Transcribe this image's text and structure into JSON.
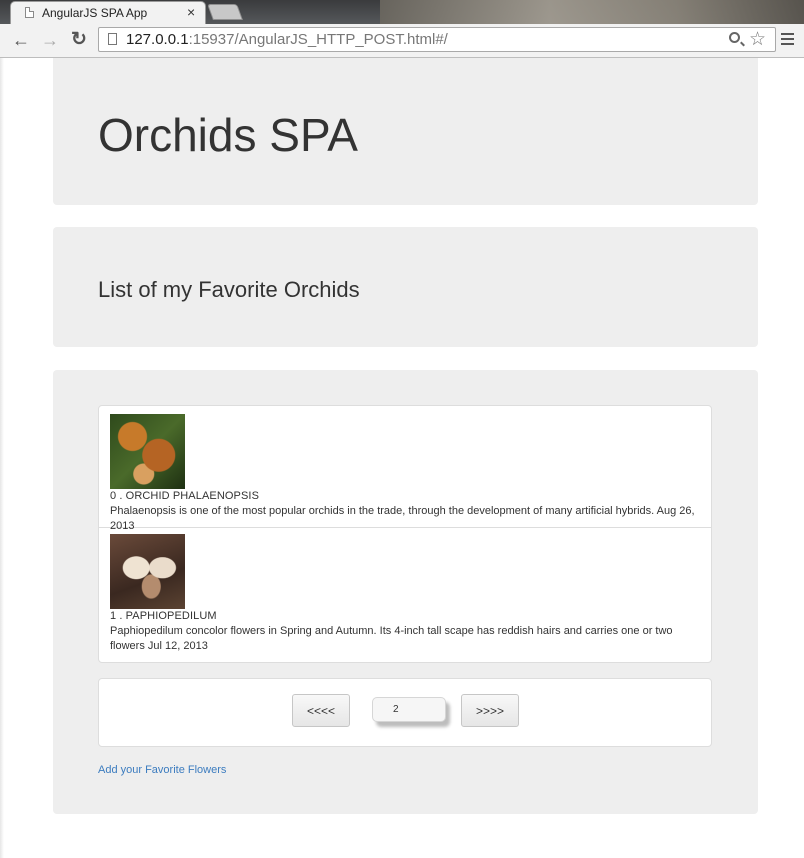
{
  "browser": {
    "tab_title": "AngularJS SPA App",
    "tab_close": "×",
    "url_host": "127.0.0.1",
    "url_rest": ":15937/AngularJS_HTTP_POST.html#/",
    "back_glyph": "←",
    "forward_glyph": "→",
    "reload_glyph": "↻",
    "star_glyph": "☆"
  },
  "header": {
    "title": "Orchids SPA"
  },
  "subheader": {
    "title": "List of my Favorite Orchids"
  },
  "orchids": [
    {
      "title": "0 . ORCHID PHALAENOPSIS",
      "description": "Phalaenopsis is one of the most popular orchids in the trade, through the development of many artificial hybrids. Aug 26, 2013",
      "image_icon": "orchid-phalaenopsis-photo"
    },
    {
      "title": "1 . PAPHIOPEDILUM",
      "description": "Paphiopedilum concolor flowers in Spring and Autumn. Its 4-inch tall scape has reddish hairs and carries one or two flowers Jul 12, 2013",
      "image_icon": "orchid-paphiopedilum-photo"
    }
  ],
  "pager": {
    "prev_label": "<<<<",
    "page_value": "2",
    "next_label": ">>>>"
  },
  "add_link": "Add your Favorite Flowers"
}
